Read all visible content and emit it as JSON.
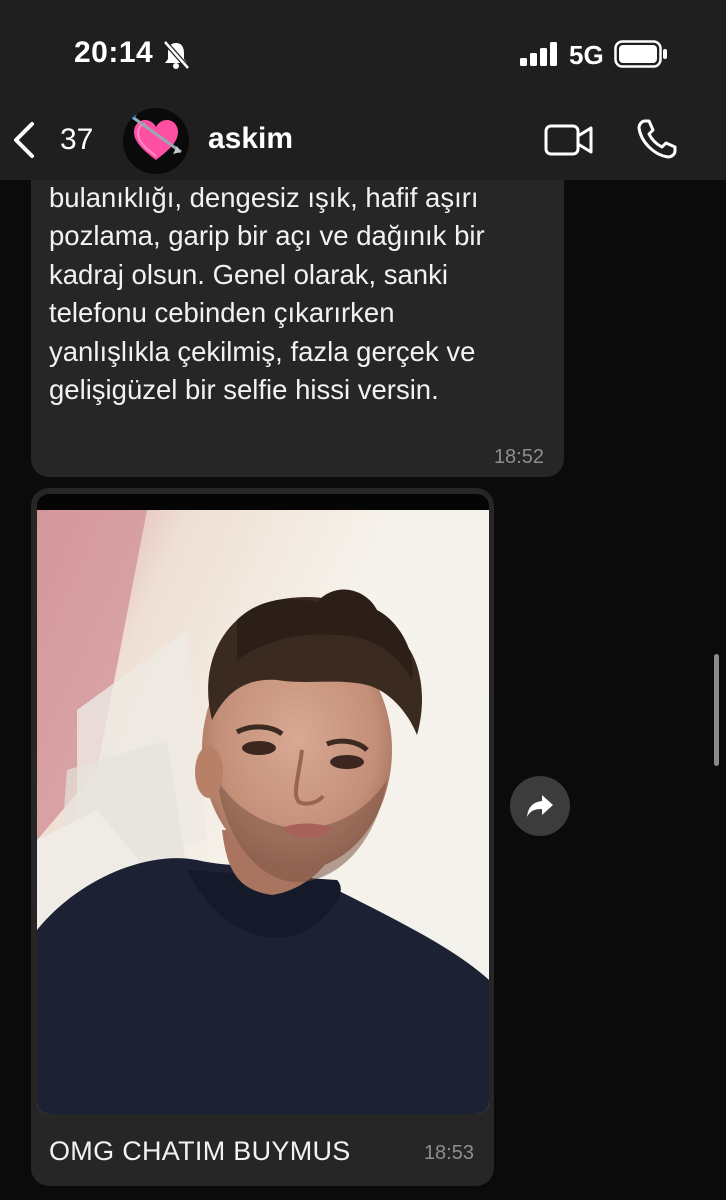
{
  "status_bar": {
    "time": "20:14",
    "network": "5G",
    "icons": [
      "bell-slash-icon",
      "cellular-signal-icon",
      "battery-icon"
    ]
  },
  "header": {
    "back_count": "37",
    "contact_name": "askim",
    "avatar": "heart-with-arrow-emoji",
    "icons": [
      "chevron-left-icon",
      "video-camera-icon",
      "phone-icon"
    ]
  },
  "messages": [
    {
      "type": "text",
      "text": "gibi olsun. Fotoğrafta hafif hareket\nbulanıklığı, dengesiz ışık, hafif aşırı\npozlama, garip bir açı ve dağınık bir\nkadraj olsun. Genel olarak, sanki\ntelefonu cebinden çıkarırken\nyanlışlıkla çekilmiş, fazla gerçek ve\ngelişigüzel bir selfie hissi versin.",
      "time": "18:52"
    },
    {
      "type": "photo",
      "caption": "OMG CHATIM BUYMUS",
      "time": "18:53"
    }
  ],
  "colors": {
    "background": "#0b0b0b",
    "header": "#1f1f1f",
    "bubble": "#262626",
    "timestamp": "#8e8e8e"
  }
}
